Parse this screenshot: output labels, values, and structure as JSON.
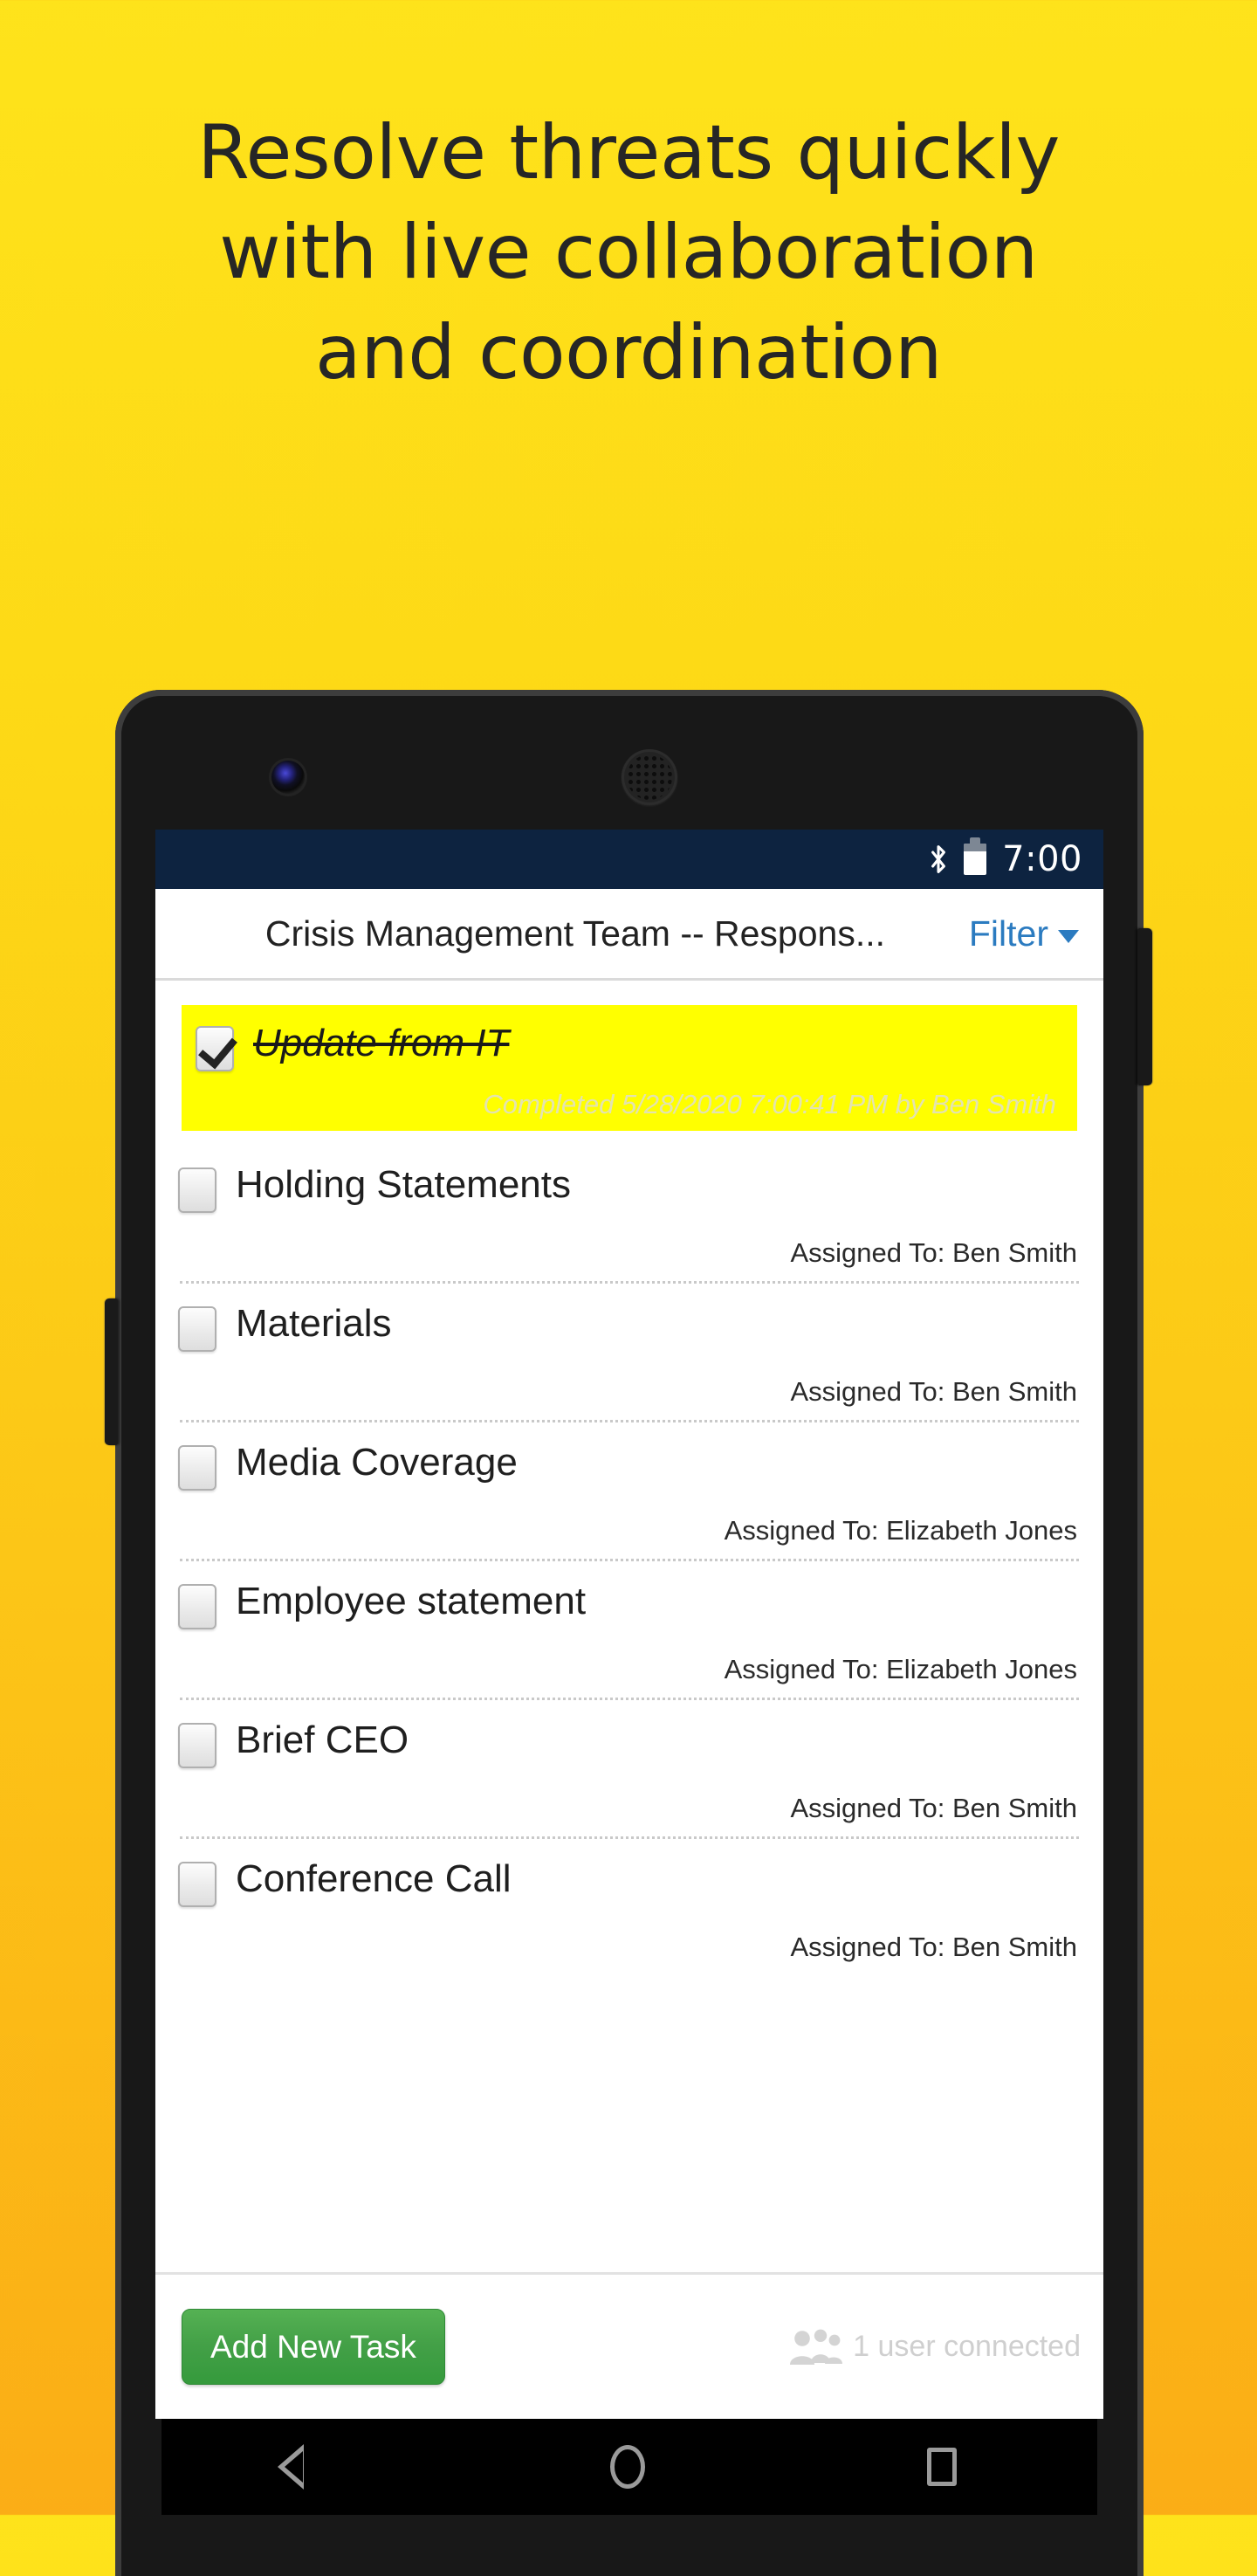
{
  "promo": {
    "headline_lines": [
      "Resolve threats quickly",
      "with live collaboration",
      "and coordination"
    ],
    "background_color_top": "#FEE31B",
    "background_color_bottom": "#FBAD16"
  },
  "device": {
    "status_bar": {
      "bluetooth_icon": "bluetooth-icon",
      "battery_icon": "battery-icon",
      "time": "7:00",
      "background_color": "#0d2340"
    },
    "nav_bar": {
      "back": "back-triangle-icon",
      "home": "home-circle-icon",
      "recents": "recents-square-icon"
    }
  },
  "app": {
    "title": "Crisis Management Team -- Respons...",
    "filter_label": "Filter",
    "filter_caret": "chevron-down-icon",
    "accent_color": "#2b7bc0",
    "highlight_color": "#ffff00",
    "tasks": [
      {
        "name": "Update from IT",
        "checked": true,
        "completed": true,
        "meta": "Completed 5/28/2020 7:00:41 PM by Ben Smith"
      },
      {
        "name": "Holding Statements",
        "checked": false,
        "completed": false,
        "meta": "Assigned To: Ben Smith"
      },
      {
        "name": "Materials",
        "checked": false,
        "completed": false,
        "meta": "Assigned To: Ben Smith"
      },
      {
        "name": "Media Coverage",
        "checked": false,
        "completed": false,
        "meta": "Assigned To: Elizabeth Jones"
      },
      {
        "name": "Employee statement",
        "checked": false,
        "completed": false,
        "meta": "Assigned To: Elizabeth Jones"
      },
      {
        "name": "Brief CEO",
        "checked": false,
        "completed": false,
        "meta": "Assigned To: Ben Smith"
      },
      {
        "name": "Conference Call",
        "checked": false,
        "completed": false,
        "meta": "Assigned To: Ben Smith"
      }
    ],
    "bottom_bar": {
      "add_task_label": "Add New Task",
      "add_task_color": "#43a047",
      "connected_label": "1 user connected",
      "connected_icon": "users-group-icon"
    }
  }
}
